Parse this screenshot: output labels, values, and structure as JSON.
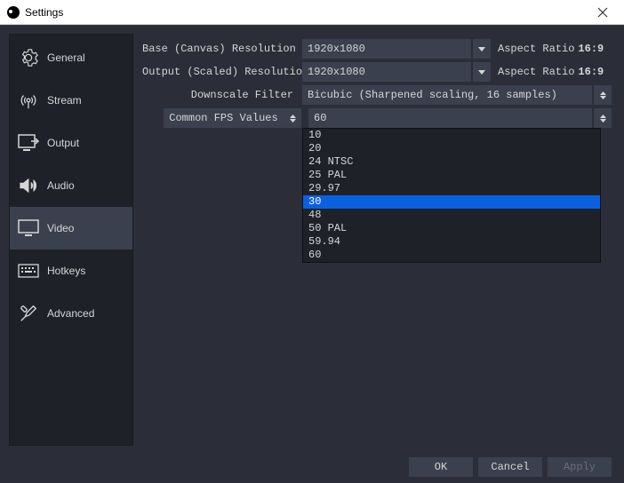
{
  "window": {
    "title": "Settings"
  },
  "sidebar": {
    "items": [
      {
        "key": "general",
        "label": "General"
      },
      {
        "key": "stream",
        "label": "Stream"
      },
      {
        "key": "output",
        "label": "Output"
      },
      {
        "key": "audio",
        "label": "Audio"
      },
      {
        "key": "video",
        "label": "Video",
        "selected": true
      },
      {
        "key": "hotkeys",
        "label": "Hotkeys"
      },
      {
        "key": "advanced",
        "label": "Advanced"
      }
    ]
  },
  "video": {
    "base_label": "Base (Canvas) Resolution",
    "base_value": "1920x1080",
    "base_aspect_label": "Aspect Ratio",
    "base_aspect_value": "16:9",
    "output_label": "Output (Scaled) Resolution",
    "output_value": "1920x1080",
    "output_aspect_label": "Aspect Ratio",
    "output_aspect_value": "16:9",
    "downscale_label": "Downscale Filter",
    "downscale_value": "Bicubic (Sharpened scaling, 16 samples)",
    "fps_type_label": "Common FPS Values",
    "fps_value": "60",
    "fps_options": [
      "10",
      "20",
      "24 NTSC",
      "25 PAL",
      "29.97",
      "30",
      "48",
      "50 PAL",
      "59.94",
      "60"
    ],
    "fps_highlight": "30"
  },
  "footer": {
    "ok": "OK",
    "cancel": "Cancel",
    "apply": "Apply"
  }
}
